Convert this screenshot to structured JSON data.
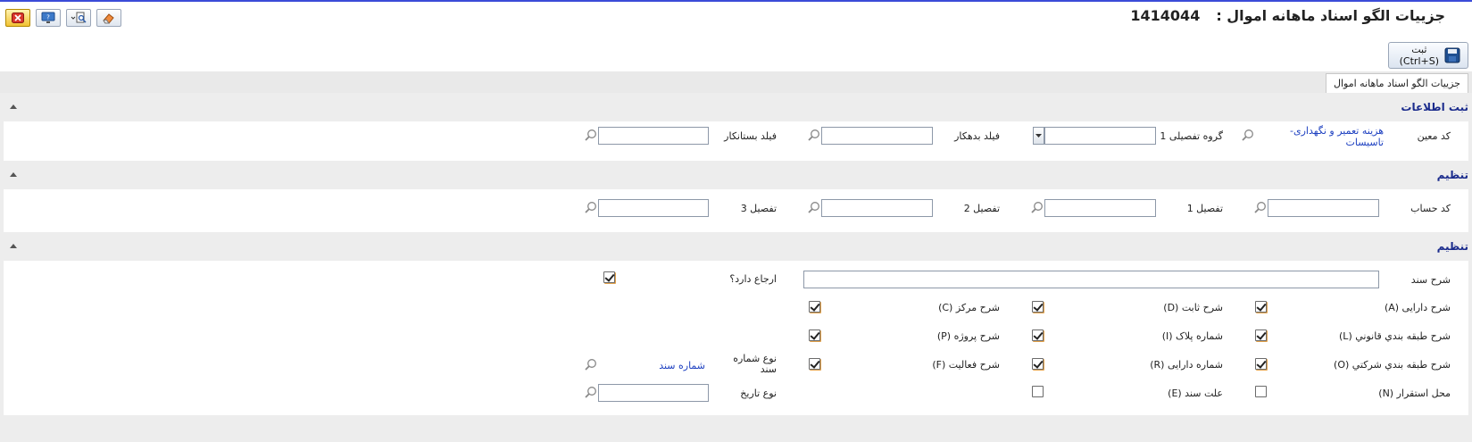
{
  "header": {
    "title": "جزییات الگو اسناد ماهانه اموال :",
    "record_number": "1414044"
  },
  "toolbar": {
    "save_label_line1": "ثبت",
    "save_label_line2": "(Ctrl+S)"
  },
  "tabs": [
    {
      "label": "جزییات الگو اسناد ماهانه اموال"
    }
  ],
  "sections": {
    "s1": {
      "title": "ثبت اطلاعات",
      "moein_label": "کد معین",
      "moein_value_line1": "هزینه تعمیر و نگهداری-",
      "moein_value_line2": "تاسیسات",
      "group_label": "گروه تفصیلی 1",
      "debtor_label": "فیلد بدهکار",
      "creditor_label": "فیلد بستانکار"
    },
    "s2": {
      "title": "تنظیم",
      "account_label": "کد حساب",
      "detail1_label": "تفصیل 1",
      "detail2_label": "تفصیل 2",
      "detail3_label": "تفصیل 3"
    },
    "s3": {
      "title": "تنظیم",
      "doc_desc_label": "شرح سند",
      "has_ref_label": "ارجاع دارد؟",
      "asset_desc_label": "شرح دارایی (A)",
      "fixed_desc_label": "شرح ثابت (D)",
      "center_desc_label": "شرح مرکز (C)",
      "legal_class_label": "شرح طبقه بندي قانوني (L)",
      "plate_no_label": "شماره پلاک (I)",
      "project_desc_label": "شرح پروژه (P)",
      "company_class_label": "شرح طبقه بندي شرکتي (O)",
      "asset_no_label": "شماره دارایی (R)",
      "activity_desc_label": "شرح فعالیت (F)",
      "docnum_type_label_line1": "نوع شماره",
      "docnum_type_label_line2": "سند",
      "docnum_type_value": "شماره سند",
      "location_label": "محل استقرار (N)",
      "doc_reason_label": "علت سند (E)",
      "date_type_label": "نوع تاریخ"
    }
  },
  "checks": {
    "has_ref": true,
    "asset_desc": true,
    "fixed_desc": true,
    "center_desc": true,
    "legal_class": true,
    "plate_no": true,
    "project_desc": true,
    "company_class": true,
    "asset_no": true,
    "activity_desc": true,
    "location": false,
    "doc_reason": false
  },
  "colors": {
    "accent": "#1a2b8c",
    "link": "#1c3fc0",
    "section_bg": "#ededed"
  }
}
